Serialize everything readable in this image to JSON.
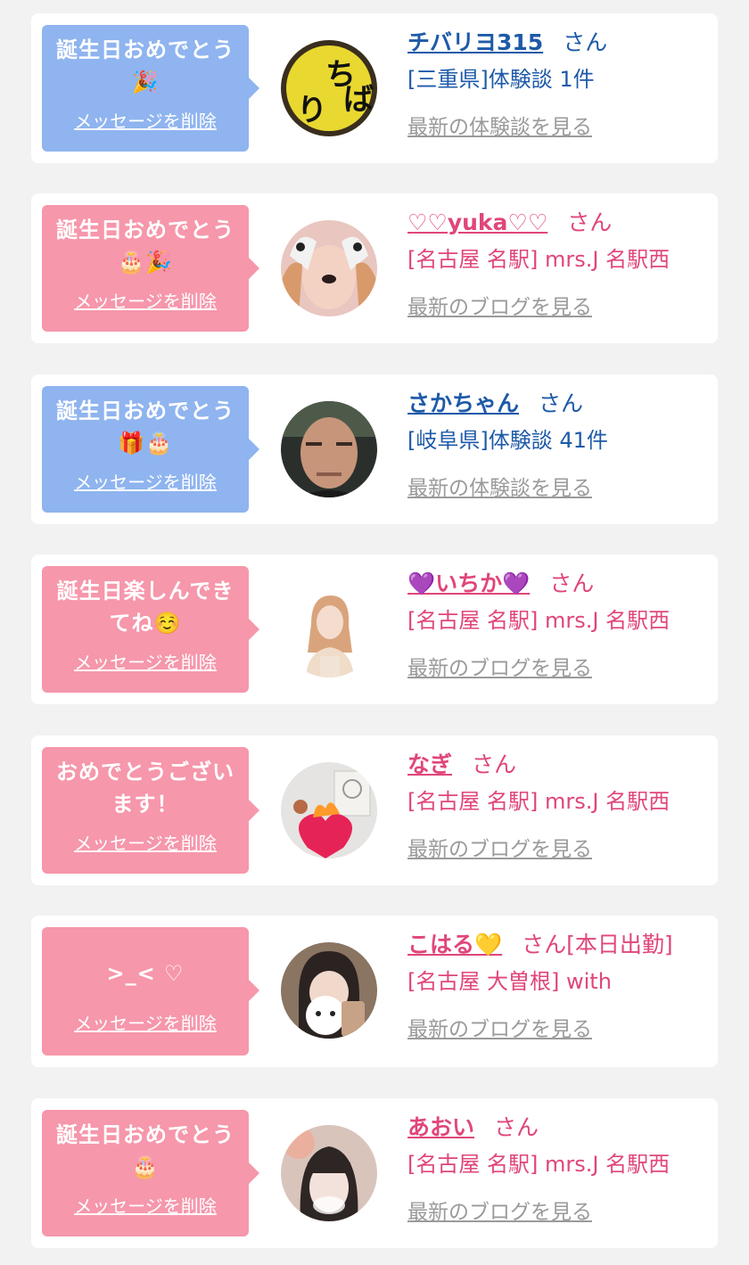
{
  "cards": [
    {
      "theme": "blue",
      "message": "誕生日おめでとう\n🎉",
      "delete_label": "メッセージを削除",
      "name": "チバリヨ315",
      "suffix": "さん",
      "detail": "[三重県]体験談 1件",
      "link": "最新の体験談を見る",
      "avatar": "avatar-yellow-sign"
    },
    {
      "theme": "pink",
      "message": "誕生日おめでとう\n🎂🎉",
      "delete_label": "メッセージを削除",
      "name": "♡♡yuka♡♡",
      "suffix": "さん",
      "detail": "[名古屋 名駅] mrs.J 名駅西",
      "link": "最新のブログを見る",
      "avatar": "avatar-dog-filter"
    },
    {
      "theme": "blue",
      "message": "誕生日おめでとう\n🎁🎂",
      "delete_label": "メッセージを削除",
      "name": "さかちゃん",
      "suffix": "さん",
      "detail": "[岐阜県]体験談 41件",
      "link": "最新の体験談を見る",
      "avatar": "avatar-man"
    },
    {
      "theme": "pink",
      "message": "誕生日楽しんでき\nてね☺️",
      "delete_label": "メッセージを削除",
      "name": "💜いちか💜",
      "suffix": "さん",
      "detail": "[名古屋 名駅] mrs.J 名駅西",
      "link": "最新のブログを見る",
      "avatar": "avatar-woman-white"
    },
    {
      "theme": "pink",
      "message": "おめでとうござい\nます！",
      "delete_label": "メッセージを削除",
      "name": "なぎ",
      "suffix": "さん",
      "detail": "[名古屋 名駅] mrs.J 名駅西",
      "link": "最新のブログを見る",
      "avatar": "avatar-heart-sticker"
    },
    {
      "theme": "pink",
      "message": ">_< ♡",
      "delete_label": "メッセージを削除",
      "name": "こはる💛",
      "suffix": "さん[本日出勤]",
      "detail": "[名古屋 大曽根] with",
      "link": "最新のブログを見る",
      "avatar": "avatar-mirror-selfie"
    },
    {
      "theme": "pink",
      "message": "誕生日おめでとう\n🎂",
      "delete_label": "メッセージを削除",
      "name": "あおい",
      "suffix": "さん",
      "detail": "[名古屋 名駅] mrs.J 名駅西",
      "link": "最新のブログを見る",
      "avatar": "avatar-blurred-face"
    }
  ]
}
